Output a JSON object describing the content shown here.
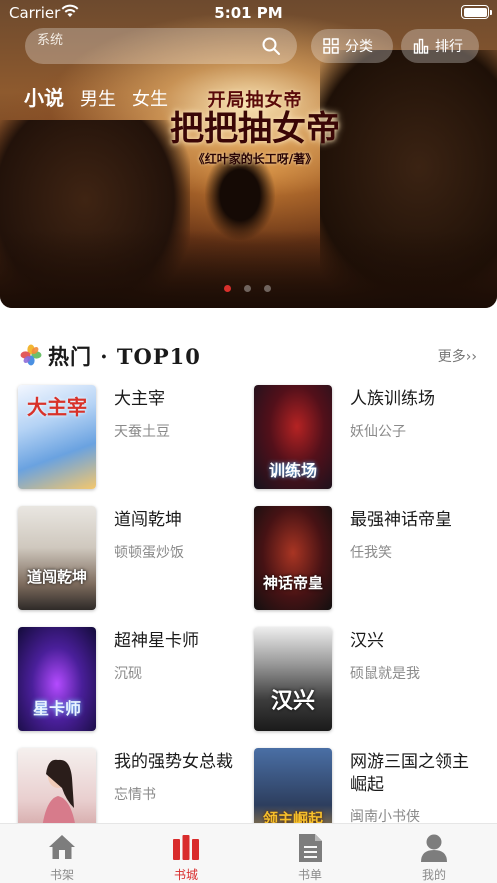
{
  "status_bar": {
    "carrier": "Carrier",
    "time": "5:01 PM"
  },
  "header": {
    "search_placeholder": "系统",
    "category_label": "分类",
    "ranking_label": "排行",
    "tabs": [
      {
        "label": "小说",
        "active": true
      },
      {
        "label": "男生",
        "active": false
      },
      {
        "label": "女生",
        "active": false
      }
    ]
  },
  "banner": {
    "subtitle": "开局抽女帝",
    "title": "把把抽女帝",
    "author_line": "《红叶家的长工呀/著》",
    "slide_count": 3,
    "active_slide": 0
  },
  "hot_section": {
    "title": "热门 · TOP10",
    "more_label": "更多",
    "books": [
      {
        "name": "大主宰",
        "author": "天蚕土豆",
        "cover_text": "大主宰"
      },
      {
        "name": "人族训练场",
        "author": "妖仙公子",
        "cover_text": "训练场"
      },
      {
        "name": "道闯乾坤",
        "author": "顿顿蛋炒饭",
        "cover_text": "道闯乾坤"
      },
      {
        "name": "最强神话帝皇",
        "author": "任我笑",
        "cover_text": "神话帝皇"
      },
      {
        "name": "超神星卡师",
        "author": "沉砚",
        "cover_text": "星卡师"
      },
      {
        "name": "汉兴",
        "author": "硕鼠就是我",
        "cover_text": "汉兴"
      },
      {
        "name": "我的强势女总裁",
        "author": "忘情书",
        "cover_text": ""
      },
      {
        "name": "网游三国之领主崛起",
        "author": "闽南小书侠",
        "cover_text": "领主崛起"
      }
    ]
  },
  "tabbar": {
    "items": [
      {
        "label": "书架",
        "icon": "house-icon",
        "active": false
      },
      {
        "label": "书城",
        "icon": "books-icon",
        "active": true
      },
      {
        "label": "书单",
        "icon": "document-icon",
        "active": false
      },
      {
        "label": "我的",
        "icon": "person-icon",
        "active": false
      }
    ]
  },
  "colors": {
    "accent": "#d92c2c",
    "text_primary": "#1a1a1a",
    "text_secondary": "#8a8a8a",
    "tab_inactive": "#8a8a8a"
  }
}
